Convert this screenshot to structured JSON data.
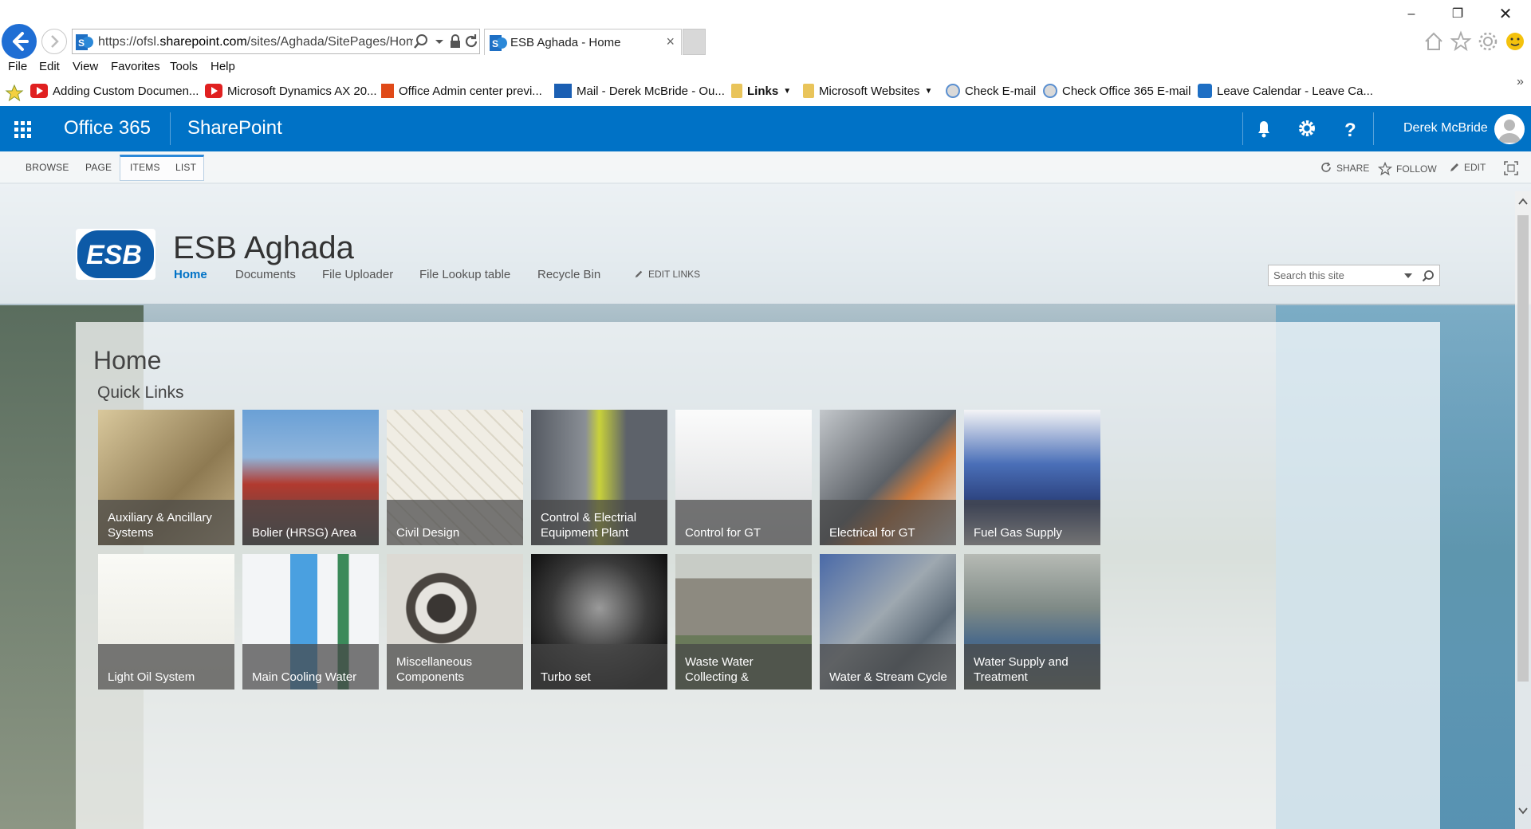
{
  "browser": {
    "url_prefix": "https://ofsl.",
    "url_domain": "sharepoint.com",
    "url_path": "/sites/Aghada/SitePages/Hom",
    "tab_title": "ESB Aghada - Home",
    "tab_close": "×",
    "menu": [
      "File",
      "Edit",
      "View",
      "Favorites",
      "Tools",
      "Help"
    ],
    "favorites": [
      {
        "label": "Adding Custom Documen...",
        "icon": "youtube-icon"
      },
      {
        "label": "Microsoft Dynamics AX 20...",
        "icon": "youtube-icon"
      },
      {
        "label": "Office Admin center previ...",
        "icon": "office-icon"
      },
      {
        "label": "Mail - Derek McBride - Ou...",
        "icon": "mail-icon"
      },
      {
        "label": "Links",
        "icon": "folder-icon"
      },
      {
        "label": "Microsoft Websites",
        "icon": "folder-icon"
      },
      {
        "label": "Check E-mail",
        "icon": "ie-icon"
      },
      {
        "label": "Check Office 365 E-mail",
        "icon": "ie-icon"
      },
      {
        "label": "Leave Calendar - Leave Ca...",
        "icon": "sharepoint-icon"
      }
    ],
    "overflow": "»"
  },
  "suitebar": {
    "brand": "Office 365",
    "app": "SharePoint",
    "user": "Derek McBride",
    "accent": "#0072c6"
  },
  "ribbon": {
    "tabs": [
      "BROWSE",
      "PAGE",
      "ITEMS",
      "LIST"
    ],
    "actions": [
      "SHARE",
      "FOLLOW",
      "EDIT"
    ]
  },
  "site": {
    "title": "ESB Aghada",
    "logo_text": "ESB",
    "nav": [
      "Home",
      "Documents",
      "File Uploader",
      "File Lookup table",
      "Recycle Bin"
    ],
    "edit_links": "EDIT LINKS",
    "search_placeholder": "Search this site"
  },
  "page": {
    "title": "Home",
    "quick_links_title": "Quick Links",
    "tiles_row1": [
      {
        "label": "Auxiliary & Ancillary Systems",
        "color": "#c9b48a"
      },
      {
        "label": "Bolier (HRSG) Area",
        "color": "#b23a2f"
      },
      {
        "label": "Civil Design",
        "color": "#e6e2d6"
      },
      {
        "label": "Control & Electrial Equipment Plant",
        "color": "#6d7380"
      },
      {
        "label": "Control for GT",
        "color": "#e9eaeb"
      },
      {
        "label": "Electrical for GT",
        "color": "#8a8f94"
      },
      {
        "label": "Fuel Gas Supply",
        "color": "#3b5fa6"
      }
    ],
    "tiles_row2": [
      {
        "label": "Light Oil System",
        "color": "#f2f2ee"
      },
      {
        "label": "Main Cooling Water",
        "color": "#e9eef2"
      },
      {
        "label": "Miscellaneous Components",
        "color": "#d8d6d2"
      },
      {
        "label": "Turbo set",
        "color": "#2c2c2c"
      },
      {
        "label": "Waste Water Collecting &",
        "color": "#7c7a72"
      },
      {
        "label": "Water & Stream Cycle",
        "color": "#7d8d98"
      },
      {
        "label": "Water Supply and Treatment",
        "color": "#8e9690"
      }
    ]
  }
}
